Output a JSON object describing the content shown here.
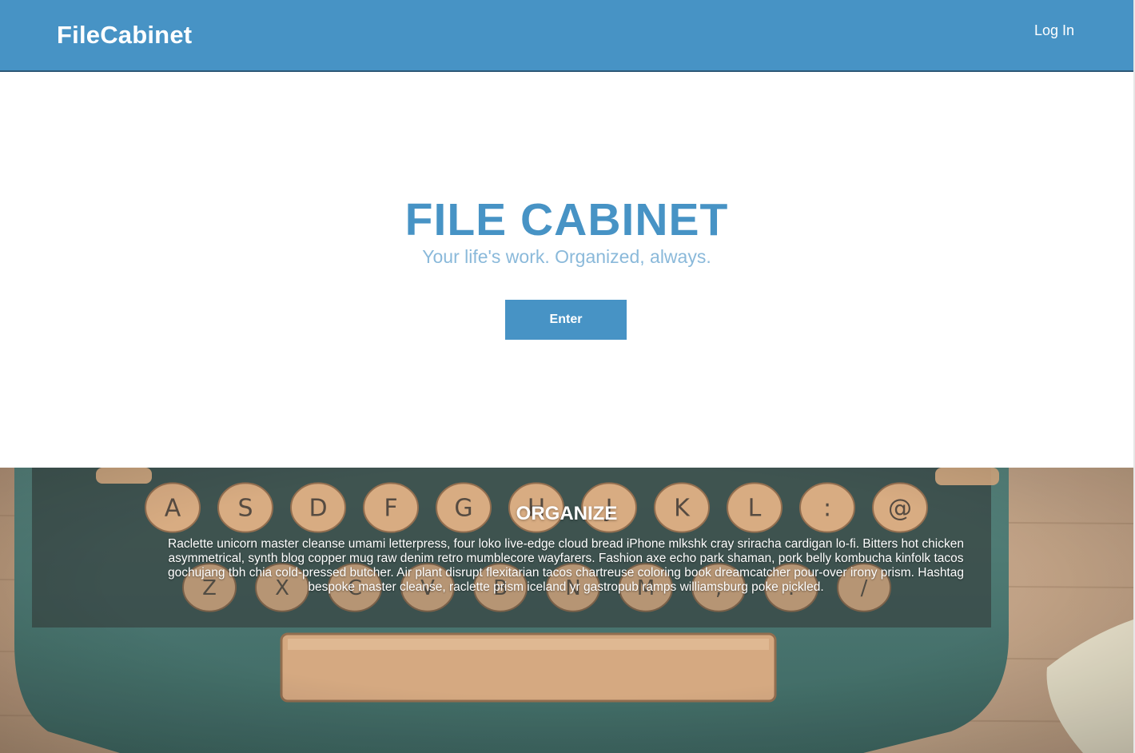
{
  "navbar": {
    "brand": "FileCabinet",
    "login_label": "Log In"
  },
  "hero": {
    "title": "FILE CABINET",
    "subtitle": "Your life's work. Organized, always.",
    "enter_label": "Enter"
  },
  "feature": {
    "title": "ORGANIZE",
    "body": "Raclette unicorn master cleanse umami letterpress, four loko live-edge cloud bread iPhone mlkshk cray sriracha cardigan lo-fi. Bitters hot chicken asymmetrical, synth blog copper mug raw denim retro mumblecore wayfarers. Fashion axe echo park shaman, pork belly kombucha kinfolk tacos gochujang tbh chia cold-pressed butcher. Air plant disrupt flexitarian tacos chartreuse coloring book dreamcatcher pour-over irony prism. Hashtag bespoke master cleanse, raclette prism iceland yr gastropub ramps williamsburg poke pickled.",
    "background_image": "typewriter-keyboard-photo",
    "keys_row1": [
      "A",
      "S",
      "D",
      "F",
      "G",
      "H",
      "J",
      "K",
      "L",
      ":",
      "@"
    ],
    "keys_row2": [
      "Z",
      "X",
      "C",
      "V",
      "B",
      "N",
      "M",
      ",",
      ".",
      "/"
    ]
  },
  "colors": {
    "brand_blue": "#4793c5",
    "subtitle_blue": "#8ab9da",
    "typewriter_body": "#3f6d66",
    "key_tan": "#d6a77b",
    "wood": "#c4a486"
  }
}
